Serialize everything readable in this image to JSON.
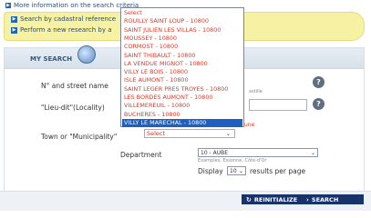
{
  "top": {
    "more_info": "More information on the search criteria"
  },
  "banner": {
    "items": [
      "Search by cadastral reference",
      "Perform a new research by a"
    ]
  },
  "panel": {
    "title": "MY SEARCH"
  },
  "form": {
    "street_label": "N° and street name",
    "lieudit_label": "\"Lieu-dit\"(Locality)",
    "town_label": "Town or \"Municipality\"",
    "town_value": "Select",
    "street_hint": "astille",
    "department_label": "Department",
    "department_value": "10 - AUBE",
    "department_hint": "Examples, Essonne, Côte-d'Or",
    "display_label": "Display",
    "display_value": "10",
    "results_label": "results per page",
    "red_hint": "une"
  },
  "dropdown": {
    "options": [
      "Select",
      "ROUILLY SAINT LOUP - 10800",
      "SAINT JULIEN LES VILLAS - 10800",
      "MOUSSEY - 10800",
      "CORMOST - 10800",
      "SAINT THIBAULT - 10800",
      "LA VENDUE MIGNOT - 10800",
      "VILLY LE BOIS - 10800",
      "ISLE AUMONT - 10800",
      "SAINT LEGER PRES TROYES - 10800",
      "LES BORDES AUMONT - 10800",
      "VILLEMEREUIL - 10800",
      "BUCHERES - 10800",
      "VILLY LE MARECHAL - 10800"
    ],
    "selected_index": 13
  },
  "buttons": {
    "reinitialize": "REINITIALIZE",
    "search": "SEARCH"
  }
}
